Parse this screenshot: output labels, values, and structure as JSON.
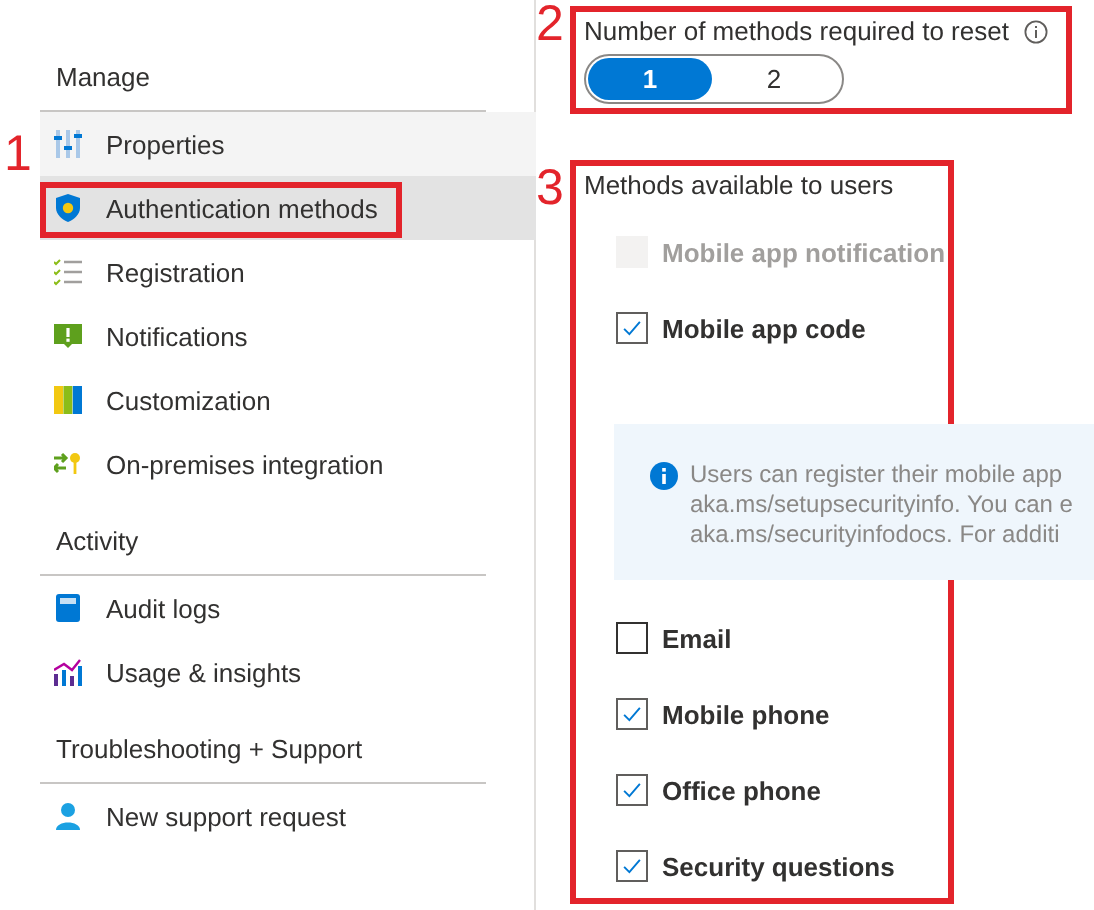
{
  "sidebar": {
    "sections": [
      {
        "heading": "Manage",
        "items": [
          {
            "label": "Properties",
            "selected": false,
            "hovered": true
          },
          {
            "label": "Authentication methods",
            "selected": true,
            "hovered": false,
            "callout": "1"
          },
          {
            "label": "Registration",
            "selected": false,
            "hovered": false
          },
          {
            "label": "Notifications",
            "selected": false,
            "hovered": false
          },
          {
            "label": "Customization",
            "selected": false,
            "hovered": false
          },
          {
            "label": "On-premises integration",
            "selected": false,
            "hovered": false
          }
        ]
      },
      {
        "heading": "Activity",
        "items": [
          {
            "label": "Audit logs",
            "selected": false,
            "hovered": false
          },
          {
            "label": "Usage & insights",
            "selected": false,
            "hovered": false
          }
        ]
      },
      {
        "heading": "Troubleshooting + Support",
        "items": [
          {
            "label": "New support request",
            "selected": false,
            "hovered": false
          }
        ]
      }
    ]
  },
  "reset_methods": {
    "label": "Number of methods required to reset",
    "callout": "2",
    "options": [
      {
        "label": "1",
        "selected": true
      },
      {
        "label": "2",
        "selected": false
      }
    ]
  },
  "methods": {
    "label": "Methods available to users",
    "callout": "3",
    "items": [
      {
        "kind": "checkbox",
        "label": "Mobile app notification",
        "checked": false,
        "disabled": true
      },
      {
        "kind": "checkbox",
        "label": "Mobile app code",
        "checked": true,
        "disabled": false
      },
      {
        "kind": "info",
        "lines": [
          "Users can register their mobile app",
          "aka.ms/setupsecurityinfo. You can e",
          "aka.ms/securityinfodocs. For additi"
        ]
      },
      {
        "kind": "checkbox",
        "label": "Email",
        "checked": false,
        "disabled": false
      },
      {
        "kind": "checkbox",
        "label": "Mobile phone",
        "checked": true,
        "disabled": false
      },
      {
        "kind": "checkbox",
        "label": "Office phone",
        "checked": true,
        "disabled": false
      },
      {
        "kind": "checkbox",
        "label": "Security questions",
        "checked": true,
        "disabled": false
      }
    ]
  }
}
